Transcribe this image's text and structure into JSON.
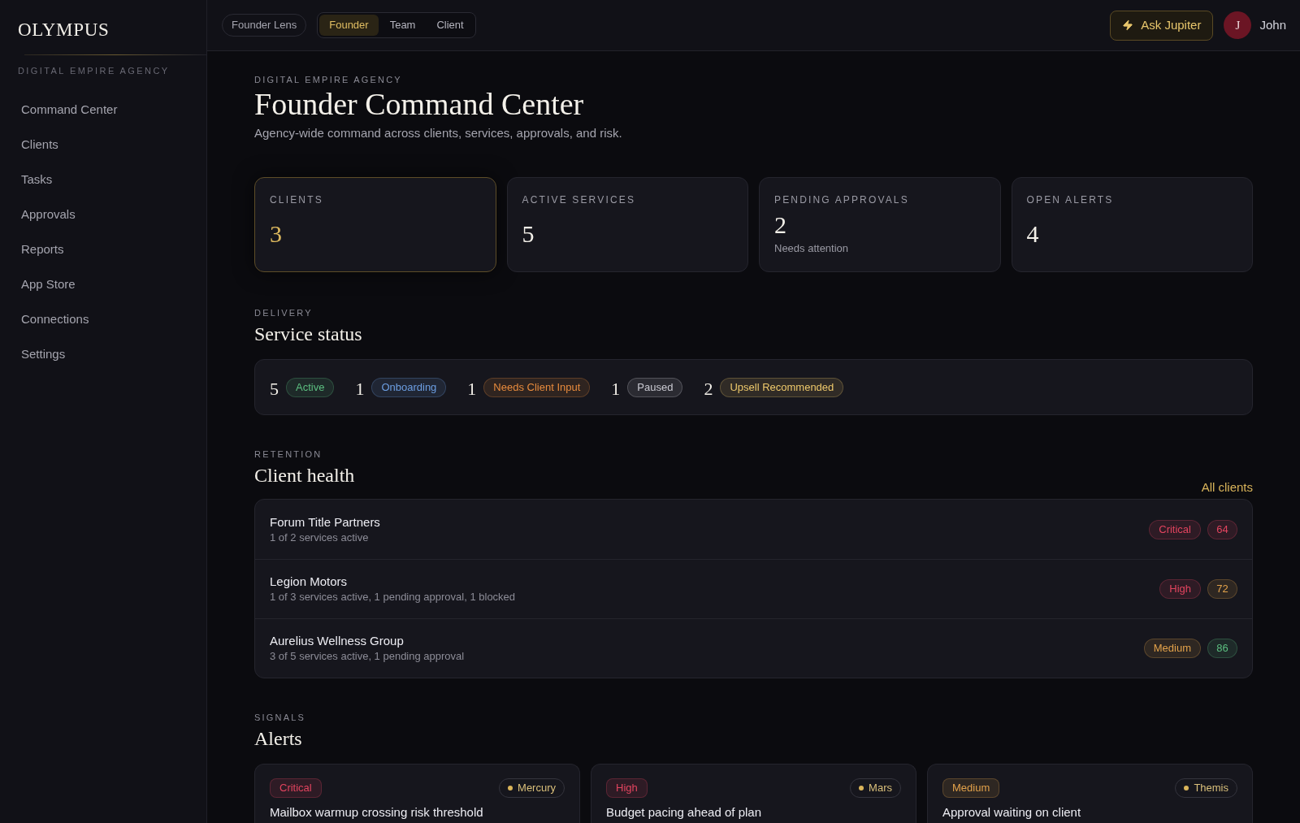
{
  "sidebar": {
    "logo": "OLYMPUS",
    "agency": "DIGITAL EMPIRE AGENCY",
    "items": [
      {
        "label": "Command Center",
        "selected": false
      },
      {
        "label": "Clients",
        "selected": false
      },
      {
        "label": "Tasks",
        "selected": false
      },
      {
        "label": "Approvals",
        "selected": false
      },
      {
        "label": "Reports",
        "selected": false
      },
      {
        "label": "App Store",
        "selected": false
      },
      {
        "label": "Connections",
        "selected": false
      },
      {
        "label": "Settings",
        "selected": false
      }
    ]
  },
  "topbar": {
    "lens": "Founder Lens",
    "views": [
      {
        "label": "Founder",
        "selected": true
      },
      {
        "label": "Team",
        "selected": false
      },
      {
        "label": "Client",
        "selected": false
      }
    ],
    "ask_button": "Ask Jupiter",
    "user": {
      "initial": "J",
      "name": "John"
    }
  },
  "header": {
    "eyebrow": "DIGITAL EMPIRE AGENCY",
    "title": "Founder Command Center",
    "subtitle": "Agency-wide command across clients, services, approvals, and risk."
  },
  "stats": [
    {
      "label": "CLIENTS",
      "value": "3",
      "highlighted": true
    },
    {
      "label": "ACTIVE SERVICES",
      "value": "5",
      "highlighted": false
    },
    {
      "label": "PENDING APPROVALS",
      "value": "2",
      "note": "Needs attention",
      "highlighted": false
    },
    {
      "label": "OPEN ALERTS",
      "value": "4",
      "highlighted": false
    }
  ],
  "service_status": {
    "eyebrow": "DELIVERY",
    "title": "Service status",
    "items": [
      {
        "count": "5",
        "label": "Active",
        "color": "#5cbf80"
      },
      {
        "count": "1",
        "label": "Onboarding",
        "color": "#6c9ee2"
      },
      {
        "count": "1",
        "label": "Needs Client Input",
        "color": "#e88b3d"
      },
      {
        "count": "1",
        "label": "Paused",
        "color": "#c9c9d1"
      },
      {
        "count": "2",
        "label": "Upsell Recommended",
        "color": "#edc86b"
      }
    ]
  },
  "client_health": {
    "eyebrow": "RETENTION",
    "title": "Client health",
    "link": "All clients",
    "rows": [
      {
        "name": "Forum Title Partners",
        "detail": "1 of 2 services active",
        "risk": {
          "label": "Critical",
          "color": "#e2445f"
        },
        "score": {
          "value": "64",
          "color": "#e2445f"
        }
      },
      {
        "name": "Legion Motors",
        "detail": "1 of 3 services active, 1 pending approval, 1 blocked",
        "risk": {
          "label": "High",
          "color": "#e2445f"
        },
        "score": {
          "value": "72",
          "color": "#e2a24b"
        }
      },
      {
        "name": "Aurelius Wellness Group",
        "detail": "3 of 5 services active, 1 pending approval",
        "risk": {
          "label": "Medium",
          "color": "#e2a24b"
        },
        "score": {
          "value": "86",
          "color": "#5cbf80"
        }
      }
    ]
  },
  "alerts": {
    "eyebrow": "SIGNALS",
    "title": "Alerts",
    "items": [
      {
        "severity": {
          "label": "Critical",
          "color": "#e2445f"
        },
        "agent": "Mercury",
        "title": "Mailbox warmup crossing risk threshold"
      },
      {
        "severity": {
          "label": "High",
          "color": "#e2445f"
        },
        "agent": "Mars",
        "title": "Budget pacing ahead of plan"
      },
      {
        "severity": {
          "label": "Medium",
          "color": "#e2a24b"
        },
        "agent": "Themis",
        "title": "Approval waiting on client"
      }
    ]
  }
}
